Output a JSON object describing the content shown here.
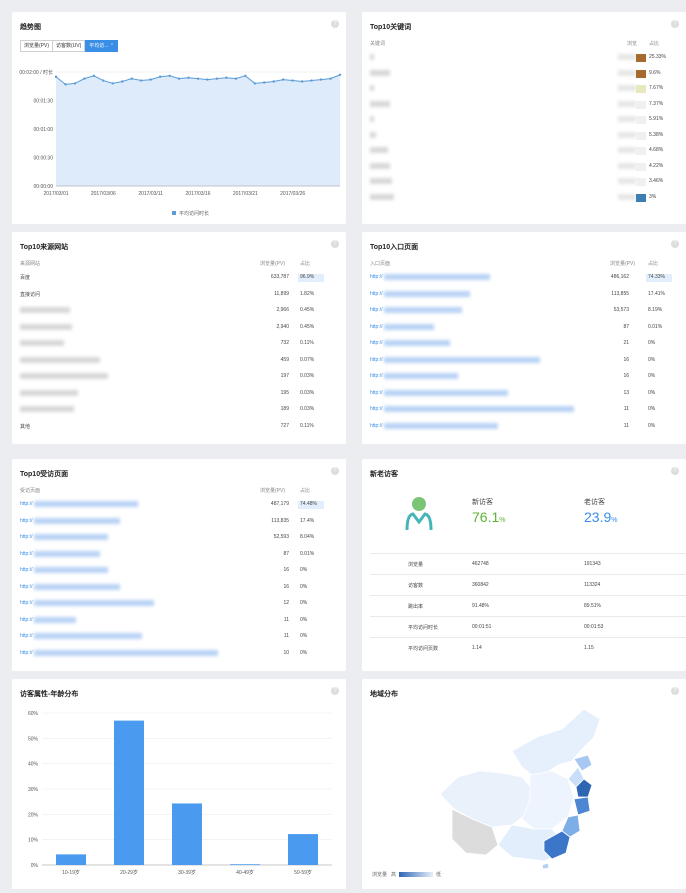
{
  "trend": {
    "title": "趋势图",
    "tabs": [
      "浏览量(PV)",
      "访客数(UV)",
      "平均访..."
    ],
    "legend": "平均访问时长",
    "chart_data": {
      "type": "area",
      "title": "",
      "x_ticks": [
        "2017/03/01",
        "2017/03/06",
        "2017/03/11",
        "2017/03/16",
        "2017/03/21",
        "2017/03/26"
      ],
      "y_ticks": [
        "00:00:00",
        "00:00:30",
        "00:01:00",
        "00:01:30",
        "00:02:00 / 时长"
      ],
      "ylim": [
        0,
        120
      ],
      "series": [
        {
          "name": "平均访问时长",
          "values": [
            115,
            107,
            108,
            113,
            116,
            111,
            108,
            110,
            113,
            111,
            112,
            115,
            116,
            113,
            114,
            113,
            112,
            113,
            114,
            113,
            116,
            108,
            109,
            110,
            112,
            111,
            110,
            111,
            112,
            113,
            117
          ]
        }
      ]
    }
  },
  "keywords": {
    "title": "Top10关键词",
    "col1": "关键词",
    "col2": "浏览",
    "col3": "占比",
    "pcts": [
      "25.33%",
      "9.6%",
      "7.67%",
      "7.37%",
      "5.91%",
      "5.38%",
      "4.68%",
      "4.22%",
      "3.46%",
      "3%"
    ]
  },
  "sources": {
    "title": "Top10来源网站",
    "col1": "来源网站",
    "col2": "浏览量(PV)",
    "col3": "占比",
    "rows": [
      {
        "name": "百度",
        "pv": "633,787",
        "pct": "96.9%"
      },
      {
        "name": "直接访问",
        "pv": "11,899",
        "pct": "1.82%"
      },
      {
        "name": "",
        "pv": "2,966",
        "pct": "0.45%"
      },
      {
        "name": "",
        "pv": "2,940",
        "pct": "0.45%"
      },
      {
        "name": "",
        "pv": "732",
        "pct": "0.11%"
      },
      {
        "name": "",
        "pv": "459",
        "pct": "0.07%"
      },
      {
        "name": "",
        "pv": "197",
        "pct": "0.03%"
      },
      {
        "name": "",
        "pv": "195",
        "pct": "0.03%"
      },
      {
        "name": "",
        "pv": "189",
        "pct": "0.03%"
      },
      {
        "name": "其他",
        "pv": "727",
        "pct": "0.11%"
      }
    ]
  },
  "entry": {
    "title": "Top10入口页面",
    "col1": "入口页面",
    "col2": "浏览量(PV)",
    "col3": "占比",
    "rows": [
      {
        "name": "http://",
        "pv": "486,162",
        "pct": "74.33%"
      },
      {
        "name": "http://",
        "pv": "113,855",
        "pct": "17.41%"
      },
      {
        "name": "http://",
        "pv": "53,573",
        "pct": "8.19%"
      },
      {
        "name": "http://",
        "pv": "87",
        "pct": "0.01%"
      },
      {
        "name": "http://",
        "pv": "21",
        "pct": "0%"
      },
      {
        "name": "http://",
        "pv": "16",
        "pct": "0%"
      },
      {
        "name": "http://",
        "pv": "16",
        "pct": "0%"
      },
      {
        "name": "http://",
        "pv": "13",
        "pct": "0%"
      },
      {
        "name": "http://",
        "pv": "11",
        "pct": "0%"
      },
      {
        "name": "http://",
        "pv": "11",
        "pct": "0%"
      }
    ]
  },
  "visited": {
    "title": "Top10受访页面",
    "col1": "受访页面",
    "col2": "浏览量(PV)",
    "col3": "占比",
    "rows": [
      {
        "name": "http://",
        "pv": "487,179",
        "pct": "74.48%"
      },
      {
        "name": "http://",
        "pv": "113,835",
        "pct": "17.4%"
      },
      {
        "name": "http://",
        "pv": "52,593",
        "pct": "8.04%"
      },
      {
        "name": "http://",
        "pv": "87",
        "pct": "0.01%"
      },
      {
        "name": "http://",
        "pv": "16",
        "pct": "0%"
      },
      {
        "name": "http://",
        "pv": "16",
        "pct": "0%"
      },
      {
        "name": "http://",
        "pv": "12",
        "pct": "0%"
      },
      {
        "name": "http://",
        "pv": "11",
        "pct": "0%"
      },
      {
        "name": "http://",
        "pv": "11",
        "pct": "0%"
      },
      {
        "name": "http://",
        "pv": "10",
        "pct": "0%"
      }
    ]
  },
  "newold": {
    "title": "新老访客",
    "new_label": "新访客",
    "new_value": "76.1",
    "old_label": "老访客",
    "old_value": "23.9",
    "unit": "%",
    "rows": [
      {
        "label": "浏览量",
        "new": "462748",
        "old": "191343"
      },
      {
        "label": "访客数",
        "new": "360842",
        "old": "113324"
      },
      {
        "label": "跳出率",
        "new": "91.48%",
        "old": "89.51%"
      },
      {
        "label": "平均访问时长",
        "new": "00:01:51",
        "old": "00:01:53"
      },
      {
        "label": "平均访问页数",
        "new": "1.14",
        "old": "1.15"
      }
    ]
  },
  "age": {
    "title": "访客属性-年龄分布",
    "chart_data": {
      "type": "bar",
      "title": "",
      "categories": [
        "10-19岁",
        "20-29岁",
        "30-39岁",
        "40-49岁",
        "50-59岁"
      ],
      "values": [
        4.2,
        57,
        24.3,
        0.3,
        12.2
      ],
      "y_ticks": [
        "0%",
        "10%",
        "20%",
        "30%",
        "40%",
        "50%",
        "60%"
      ],
      "ylim": [
        0,
        60
      ]
    }
  },
  "region": {
    "title": "地域分布",
    "legend_label": "浏览量",
    "legend_high": "高",
    "legend_low": "低"
  }
}
